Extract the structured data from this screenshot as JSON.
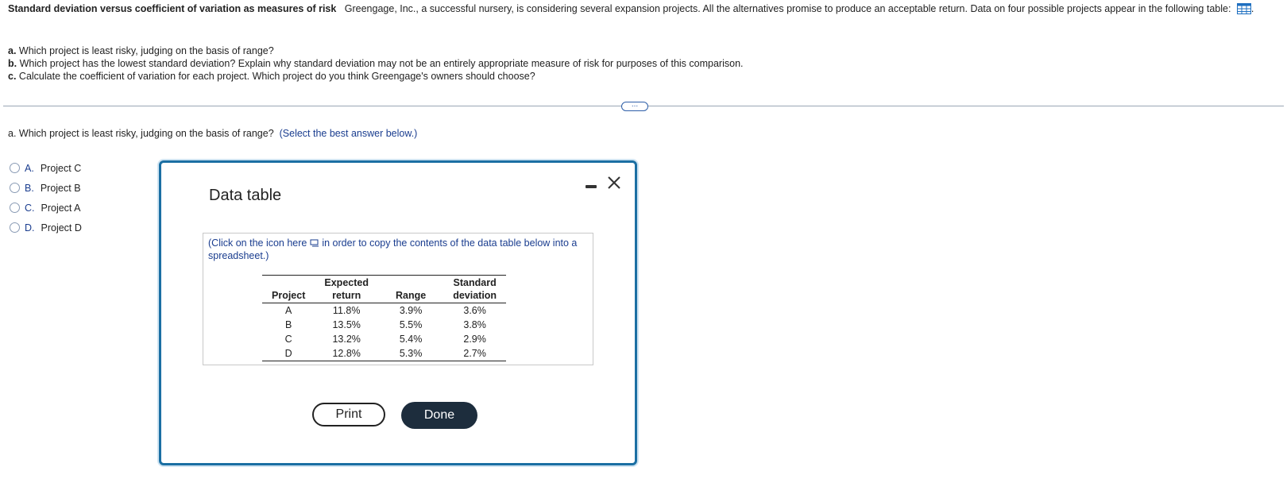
{
  "problem": {
    "title": "Standard deviation versus coefficient of variation as measures of risk",
    "intro": "Greengage, Inc., a successful nursery, is considering several expansion projects.  All the alternatives promise to produce an acceptable return.  Data on four possible projects appear in the following table:",
    "questions": [
      {
        "letter": "a.",
        "text": "Which project is least risky, judging on the basis of range?"
      },
      {
        "letter": "b.",
        "text": "Which project has the lowest standard deviation? Explain why standard deviation may not be an entirely appropriate measure of risk for purposes of this comparison."
      },
      {
        "letter": "c.",
        "text": "Calculate the coefficient of variation for each project.  Which project do you think Greengage's owners should choose?"
      }
    ]
  },
  "more_button": "...",
  "current_question": {
    "text": "a. Which project is least risky, judging on the basis of range?",
    "hint": "(Select the best answer below.)"
  },
  "options": [
    {
      "letter": "A.",
      "label": "Project C"
    },
    {
      "letter": "B.",
      "label": "Project B"
    },
    {
      "letter": "C.",
      "label": "Project A"
    },
    {
      "letter": "D.",
      "label": "Project D"
    }
  ],
  "modal": {
    "title": "Data table",
    "copy_note_before": "(Click on the icon here",
    "copy_note_after": "in order to copy the contents of the data table below into a spreadsheet.)",
    "columns": [
      [
        "Project"
      ],
      [
        "Expected",
        "return"
      ],
      [
        "Range"
      ],
      [
        "Standard",
        "deviation"
      ]
    ],
    "rows": [
      [
        "A",
        "11.8%",
        "3.9%",
        "3.6%"
      ],
      [
        "B",
        "13.5%",
        "5.5%",
        "3.8%"
      ],
      [
        "C",
        "13.2%",
        "5.4%",
        "2.9%"
      ],
      [
        "D",
        "12.8%",
        "5.3%",
        "2.7%"
      ]
    ],
    "print_label": "Print",
    "done_label": "Done"
  },
  "icons": {
    "table": "table-grid-icon",
    "copy": "copy-icon",
    "minimize": "minimize-icon",
    "close": "close-icon"
  },
  "colors": {
    "accent_blue": "#1a3d8f",
    "modal_border": "#1b6fa3",
    "done_button": "#1d2d3d"
  }
}
